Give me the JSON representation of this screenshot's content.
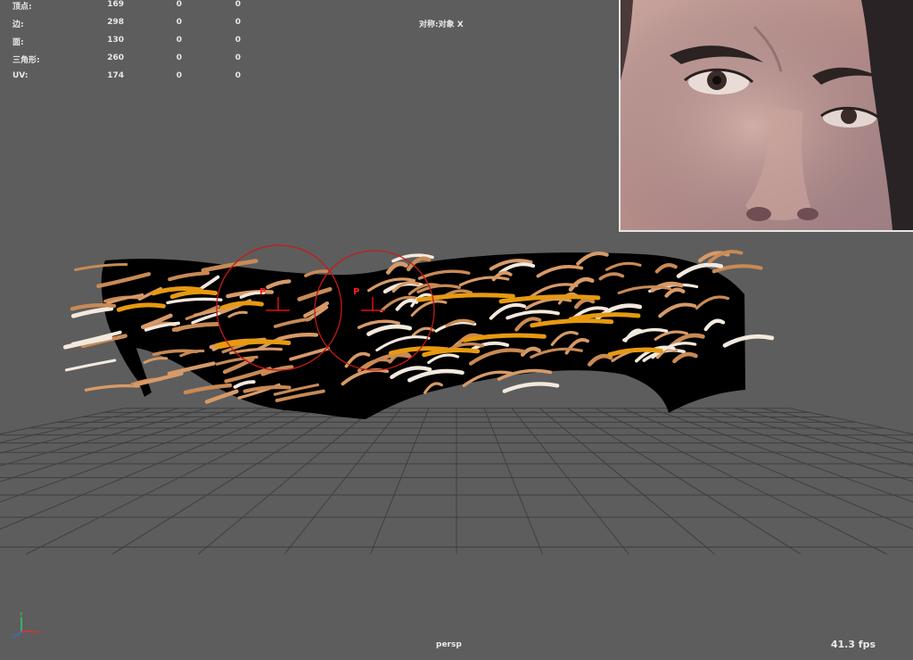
{
  "stats": {
    "rows": [
      {
        "label": "顶点:",
        "v1": "169",
        "v2": "0",
        "v3": "0"
      },
      {
        "label": "边:",
        "v1": "298",
        "v2": "0",
        "v3": "0"
      },
      {
        "label": "面:",
        "v1": "130",
        "v2": "0",
        "v3": "0"
      },
      {
        "label": "三角形:",
        "v1": "260",
        "v2": "0",
        "v3": "0"
      },
      {
        "label": "UV:",
        "v1": "174",
        "v2": "0",
        "v3": "0"
      }
    ]
  },
  "viewport": {
    "symmetry": "对称:对象 X",
    "camera": "persp",
    "fps": "41.3 fps",
    "pivot_label_left": "P",
    "pivot_label_right": "P",
    "axis_y": "Y",
    "axis_x": "X",
    "axis_z": "Z"
  },
  "colors": {
    "background": "#5d5d5d",
    "grid": "#3c3c3c",
    "mesh": "#000000",
    "strand": "#c98a55",
    "accent": "#e79a10",
    "brush": "#cc1111"
  }
}
